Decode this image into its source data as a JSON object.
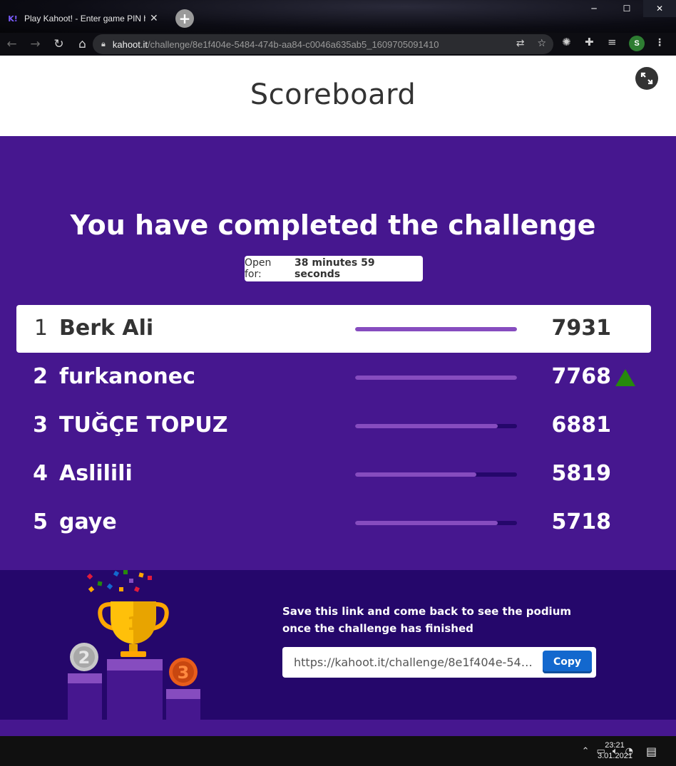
{
  "browser": {
    "tab_title": "Play Kahoot! - Enter game PIN he",
    "tab_favicon": "K!",
    "tab_close": "✕",
    "new_tab": "+",
    "url_host": "kahoot.it",
    "url_path": "/challenge/8e1f404e-5484-474b-aa84-c0046a635ab5_1609705091410",
    "profile_initial": "S"
  },
  "header": {
    "title": "Scoreboard"
  },
  "main": {
    "completed_title": "You have completed the challenge",
    "open_for_label": "Open for:",
    "open_for_value": "38 minutes 59 seconds"
  },
  "leaderboard": [
    {
      "rank": "1",
      "name": "Berk Ali",
      "score": "7931",
      "bar_fraction": 1.0,
      "is_me": true,
      "trend_up": false
    },
    {
      "rank": "2",
      "name": "furkanonec",
      "score": "7768",
      "bar_fraction": 1.0,
      "is_me": false,
      "trend_up": true
    },
    {
      "rank": "3",
      "name": "TUĞÇE TOPUZ",
      "score": "6881",
      "bar_fraction": 0.88,
      "is_me": false,
      "trend_up": false
    },
    {
      "rank": "4",
      "name": "Aslilili",
      "score": "5819",
      "bar_fraction": 0.75,
      "is_me": false,
      "trend_up": false
    },
    {
      "rank": "5",
      "name": "gaye",
      "score": "5718",
      "bar_fraction": 0.88,
      "is_me": false,
      "trend_up": false
    }
  ],
  "footer": {
    "save_text": "Save this link and come back to see the podium once the challenge has finished",
    "link_value": "https://kahoot.it/challenge/8e1f404e-548...",
    "copy_label": "Copy",
    "podium_labels": [
      "1",
      "2",
      "3"
    ]
  },
  "taskbar": {
    "time": "23:21",
    "date": "3.01.2021"
  },
  "colors": {
    "kahoot_purple": "#46178f",
    "dark_purple": "#25076b",
    "bar_fill": "#864cbf",
    "copy_blue": "#1368ce",
    "trend_green": "#26890c"
  }
}
